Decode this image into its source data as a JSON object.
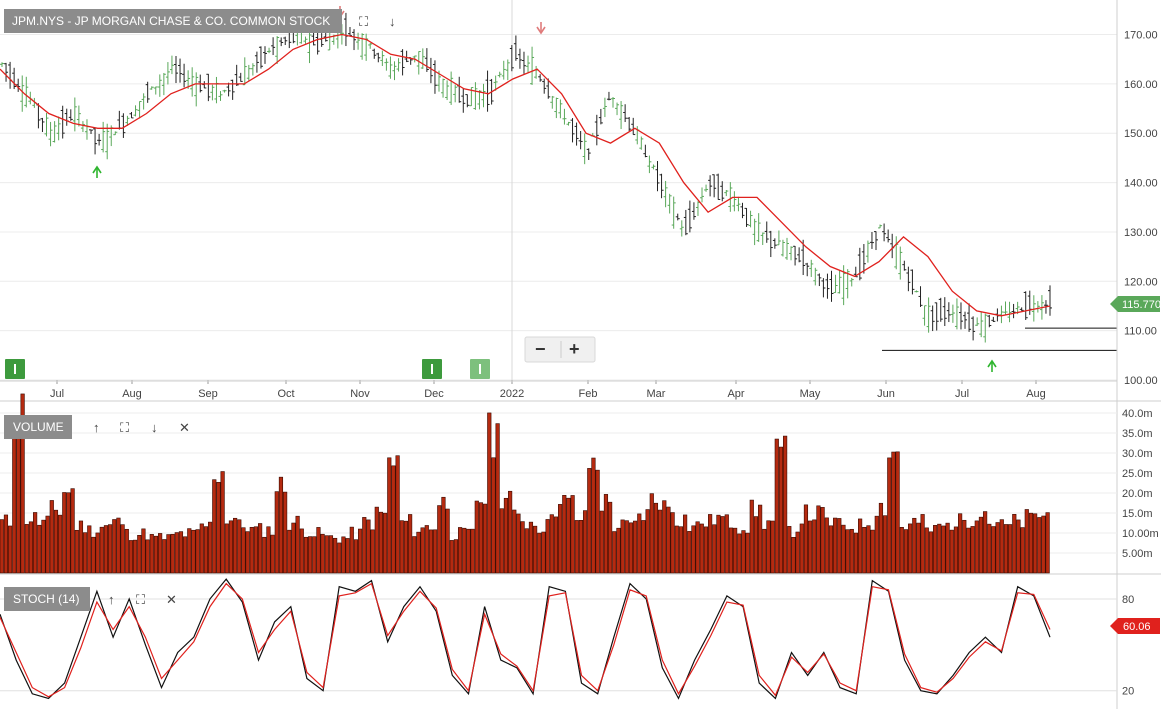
{
  "header": {
    "symbol_title": "JPM.NYS - JP MORGAN CHASE & CO. COMMON STOCK",
    "price_tag": "115.770",
    "stoch_tag": "60.06",
    "zoom_out": "−",
    "zoom_in": "+"
  },
  "panels": {
    "volume_label": "VOLUME",
    "stoch_label": "STOCH (14)"
  },
  "icons": {
    "up": "↑",
    "maximize": "⛶",
    "down": "↓",
    "close": "✕"
  },
  "colors": {
    "up_bar": "#5aa85a",
    "down_bar": "#222222",
    "ma_line": "#e0211d",
    "volume_bar": "#b52a10",
    "volume_edge": "#3a0a00",
    "stoch_k": "#111111",
    "stoch_d": "#e0211d",
    "label_bg": "#8c8c8c",
    "price_tag_bg": "#5aa85a",
    "stoch_tag_bg": "#e0211d",
    "buy_arrow": "#2fb52f",
    "sell_arrow": "#e07b7b",
    "marker_green": "#3d9a3d"
  },
  "chart_data": [
    {
      "type": "candlestick",
      "title": "JPM.NYS - JP MORGAN CHASE & CO. COMMON STOCK",
      "y_ticks": [
        "170.00",
        "160.00",
        "150.00",
        "140.00",
        "130.00",
        "120.00",
        "110.00",
        "100.00"
      ],
      "ylim": [
        100,
        177
      ],
      "x_ticks": [
        "Jul",
        "Aug",
        "Sep",
        "Oct",
        "Nov",
        "Dec",
        "2022",
        "Feb",
        "Mar",
        "Apr",
        "May",
        "Jun",
        "Jul",
        "Aug"
      ],
      "last_price": 115.77,
      "support_lines": [
        110.5,
        106.0
      ],
      "weekly_close": [
        164,
        158,
        150,
        154,
        148,
        152,
        158,
        163,
        160,
        158,
        162,
        167,
        170,
        168,
        171,
        168,
        163,
        166,
        160,
        157,
        158,
        166,
        162,
        154,
        146,
        158,
        150,
        140,
        130,
        140,
        137,
        130,
        127,
        124,
        118,
        121,
        131,
        123,
        113,
        114,
        111,
        113,
        115,
        115.77
      ],
      "moving_average": [
        163,
        158,
        154,
        152,
        151,
        151,
        154,
        158,
        160,
        160,
        160,
        163,
        167,
        169,
        170,
        169,
        166,
        165,
        162,
        159,
        158,
        161,
        163,
        158,
        150,
        148,
        151,
        148,
        140,
        134,
        137,
        137,
        132,
        127,
        123,
        121,
        124,
        129,
        125,
        118,
        114,
        113,
        114,
        115
      ]
    },
    {
      "type": "bar",
      "name": "VOLUME",
      "y_ticks": [
        "40.0m",
        "35.0m",
        "30.0m",
        "25.0m",
        "20.0m",
        "15.0m",
        "10.00m",
        "5.00m"
      ],
      "ylim": [
        0,
        42
      ],
      "unit": "m",
      "values": [
        13,
        42,
        14,
        13,
        16,
        21,
        12,
        11,
        12,
        13,
        10,
        10,
        9,
        9,
        10,
        10,
        12,
        26,
        14,
        12,
        11,
        11,
        22,
        13,
        11,
        10,
        9,
        9,
        10,
        13,
        15,
        28,
        13,
        11,
        12,
        18,
        10,
        10,
        19,
        35,
        20,
        14,
        13,
        12,
        17,
        18,
        14,
        28,
        18,
        12,
        12,
        15,
        19,
        17,
        14,
        12,
        13,
        14,
        13,
        12,
        16,
        13,
        30,
        11,
        15,
        15,
        13,
        12,
        12,
        13,
        17,
        31,
        12,
        13,
        11,
        12,
        13,
        14,
        16,
        13,
        12,
        13,
        14,
        15
      ]
    },
    {
      "type": "line",
      "name": "STOCH (14)",
      "y_ticks": [
        "80",
        "20"
      ],
      "ylim": [
        10,
        95
      ],
      "tag_value": 60.06,
      "series": [
        {
          "values": [
            70,
            40,
            18,
            15,
            25,
            55,
            85,
            55,
            80,
            50,
            22,
            45,
            55,
            80,
            93,
            78,
            40,
            65,
            75,
            28,
            20,
            88,
            85,
            92,
            52,
            75,
            88,
            72,
            30,
            18,
            75,
            40,
            35,
            18,
            88,
            85,
            25,
            18,
            55,
            90,
            80,
            35,
            15,
            40,
            60,
            82,
            75,
            25,
            15,
            45,
            30,
            45,
            22,
            18,
            92,
            85,
            40,
            20,
            18,
            30,
            45,
            55,
            45,
            88,
            82,
            55
          ]
        },
        {
          "values": [
            68,
            45,
            22,
            16,
            22,
            48,
            78,
            60,
            75,
            55,
            28,
            40,
            52,
            75,
            90,
            80,
            45,
            60,
            72,
            32,
            22,
            82,
            84,
            90,
            56,
            72,
            85,
            74,
            34,
            20,
            70,
            44,
            36,
            20,
            82,
            84,
            30,
            20,
            50,
            86,
            82,
            40,
            18,
            36,
            56,
            78,
            76,
            30,
            17,
            42,
            32,
            44,
            25,
            20,
            88,
            86,
            44,
            22,
            19,
            28,
            42,
            52,
            46,
            84,
            83,
            60
          ]
        }
      ]
    }
  ]
}
